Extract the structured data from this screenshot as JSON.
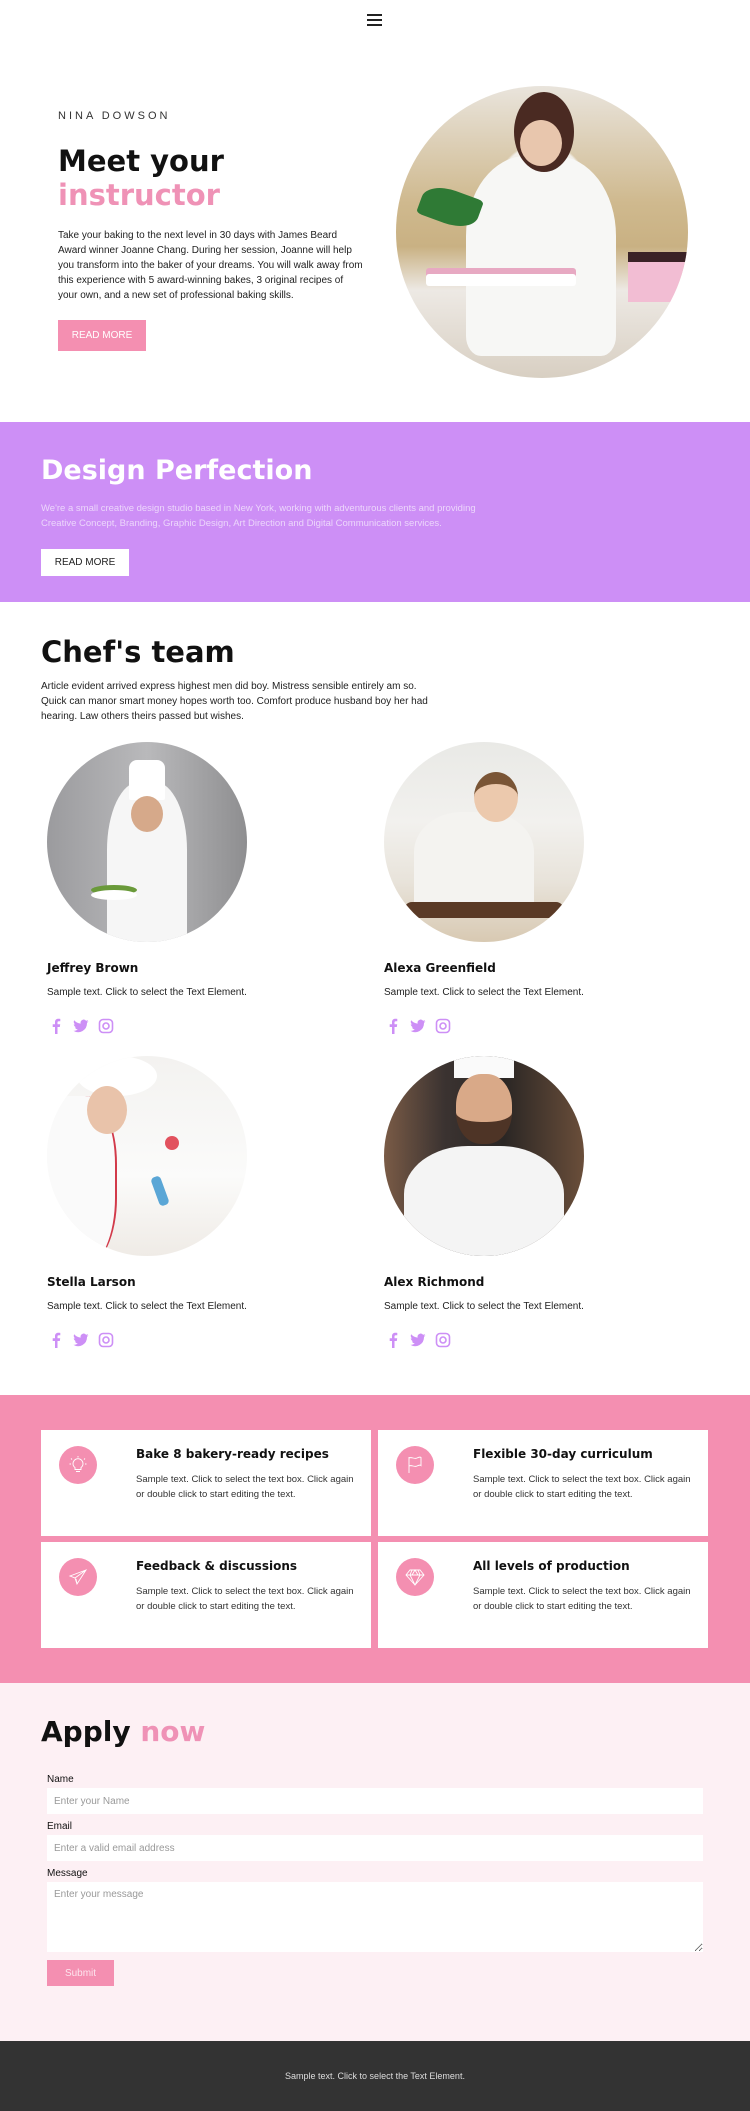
{
  "header": {
    "menu_icon": "hamburger-icon"
  },
  "hero": {
    "eyebrow": "NINA DOWSON",
    "title_line1": "Meet your",
    "title_line2": "instructor",
    "body": "Take your baking to the next level in 30 days with James Beard Award winner Joanne Chang. During her session, Joanne will help you transform into the baker of your dreams. You will walk away from this experience with 5 award-winning bakes, 3 original recipes of your own, and a new set of professional baking skills.",
    "button": "READ MORE",
    "image_alt": "Pastry chef piping macarons"
  },
  "promo": {
    "title": "Design Perfection",
    "body": "We're a small creative design studio based in New York, working with adventurous clients and providing Creative Concept, Branding, Graphic Design, Art Direction and Digital Communication services.",
    "button": "READ MORE"
  },
  "team": {
    "title": "Chef's team",
    "intro": "Article evident arrived express highest men did boy. Mistress sensible entirely am so. Quick can manor smart money hopes worth too. Comfort produce husband boy her had hearing. Law others theirs passed but wishes.",
    "members": [
      {
        "name": "Jeffrey Brown",
        "desc": "Sample text. Click to select the Text Element."
      },
      {
        "name": "Alexa Greenfield",
        "desc": "Sample text. Click to select the Text Element."
      },
      {
        "name": "Stella Larson",
        "desc": "Sample text. Click to select the Text Element."
      },
      {
        "name": "Alex Richmond",
        "desc": "Sample text. Click to select the Text Element."
      }
    ],
    "social_icons": [
      "facebook-icon",
      "twitter-icon",
      "instagram-icon"
    ]
  },
  "features": {
    "items": [
      {
        "icon": "lightbulb-icon",
        "title": "Bake 8 bakery-ready recipes",
        "desc": "Sample text. Click to select the text box. Click again or double click to start editing the text."
      },
      {
        "icon": "flag-icon",
        "title": "Flexible 30-day curriculum",
        "desc": "Sample text. Click to select the text box. Click again or double click to start editing the text."
      },
      {
        "icon": "paper-plane-icon",
        "title": "Feedback & discussions",
        "desc": "Sample text. Click to select the text box. Click again or double click to start editing the text."
      },
      {
        "icon": "diamond-icon",
        "title": "All levels of production",
        "desc": "Sample text. Click to select the text box. Click again or double click to start editing the text."
      }
    ]
  },
  "apply": {
    "title_part1": "Apply",
    "title_part2": "now",
    "name_label": "Name",
    "name_placeholder": "Enter your Name",
    "email_label": "Email",
    "email_placeholder": "Enter a valid email address",
    "message_label": "Message",
    "message_placeholder": "Enter your message",
    "submit": "Submit"
  },
  "footer": {
    "text": "Sample text. Click to select the Text Element."
  },
  "colors": {
    "pink": "#f48fb1",
    "purple": "#cd8ff6",
    "dark": "#333333",
    "light_pink_bg": "#fdf0f4"
  }
}
